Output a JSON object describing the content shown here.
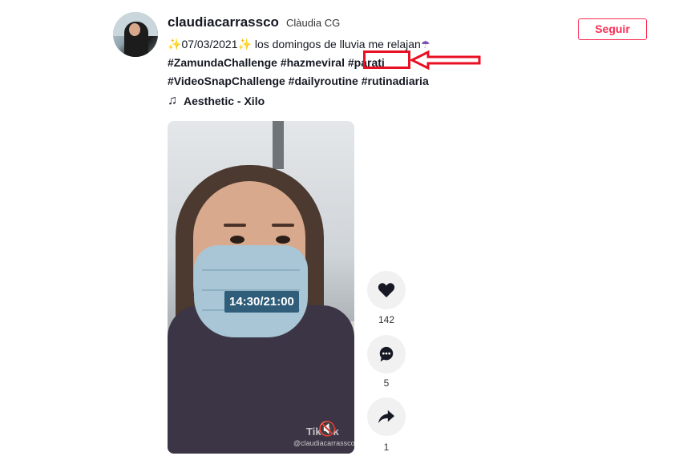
{
  "post": {
    "username": "claudiacarrassco",
    "nickname": "Clàudia CG",
    "follow_label": "Seguir",
    "caption_date": "07/03/2021",
    "caption_text": " los domingos de lluvia me relajan",
    "hashtags_line1": [
      "#ZamundaChallenge",
      "#hazmeviral",
      "#parati"
    ],
    "hashtags_line2": [
      "#VideoSnapChallenge",
      "#dailyroutine",
      "#rutinadiaria"
    ],
    "music": "Aesthetic - Xilo"
  },
  "video": {
    "timestamp": "14:30/21:00",
    "watermark": "TikTok",
    "watermark_user": "@claudiacarrassco"
  },
  "actions": {
    "likes": "142",
    "comments": "5",
    "shares": "1"
  },
  "annotation": {
    "highlight_color": "#e81123",
    "highlighted_tag": "#parati"
  },
  "colors": {
    "accent": "#fe2c55",
    "text": "#161823"
  }
}
